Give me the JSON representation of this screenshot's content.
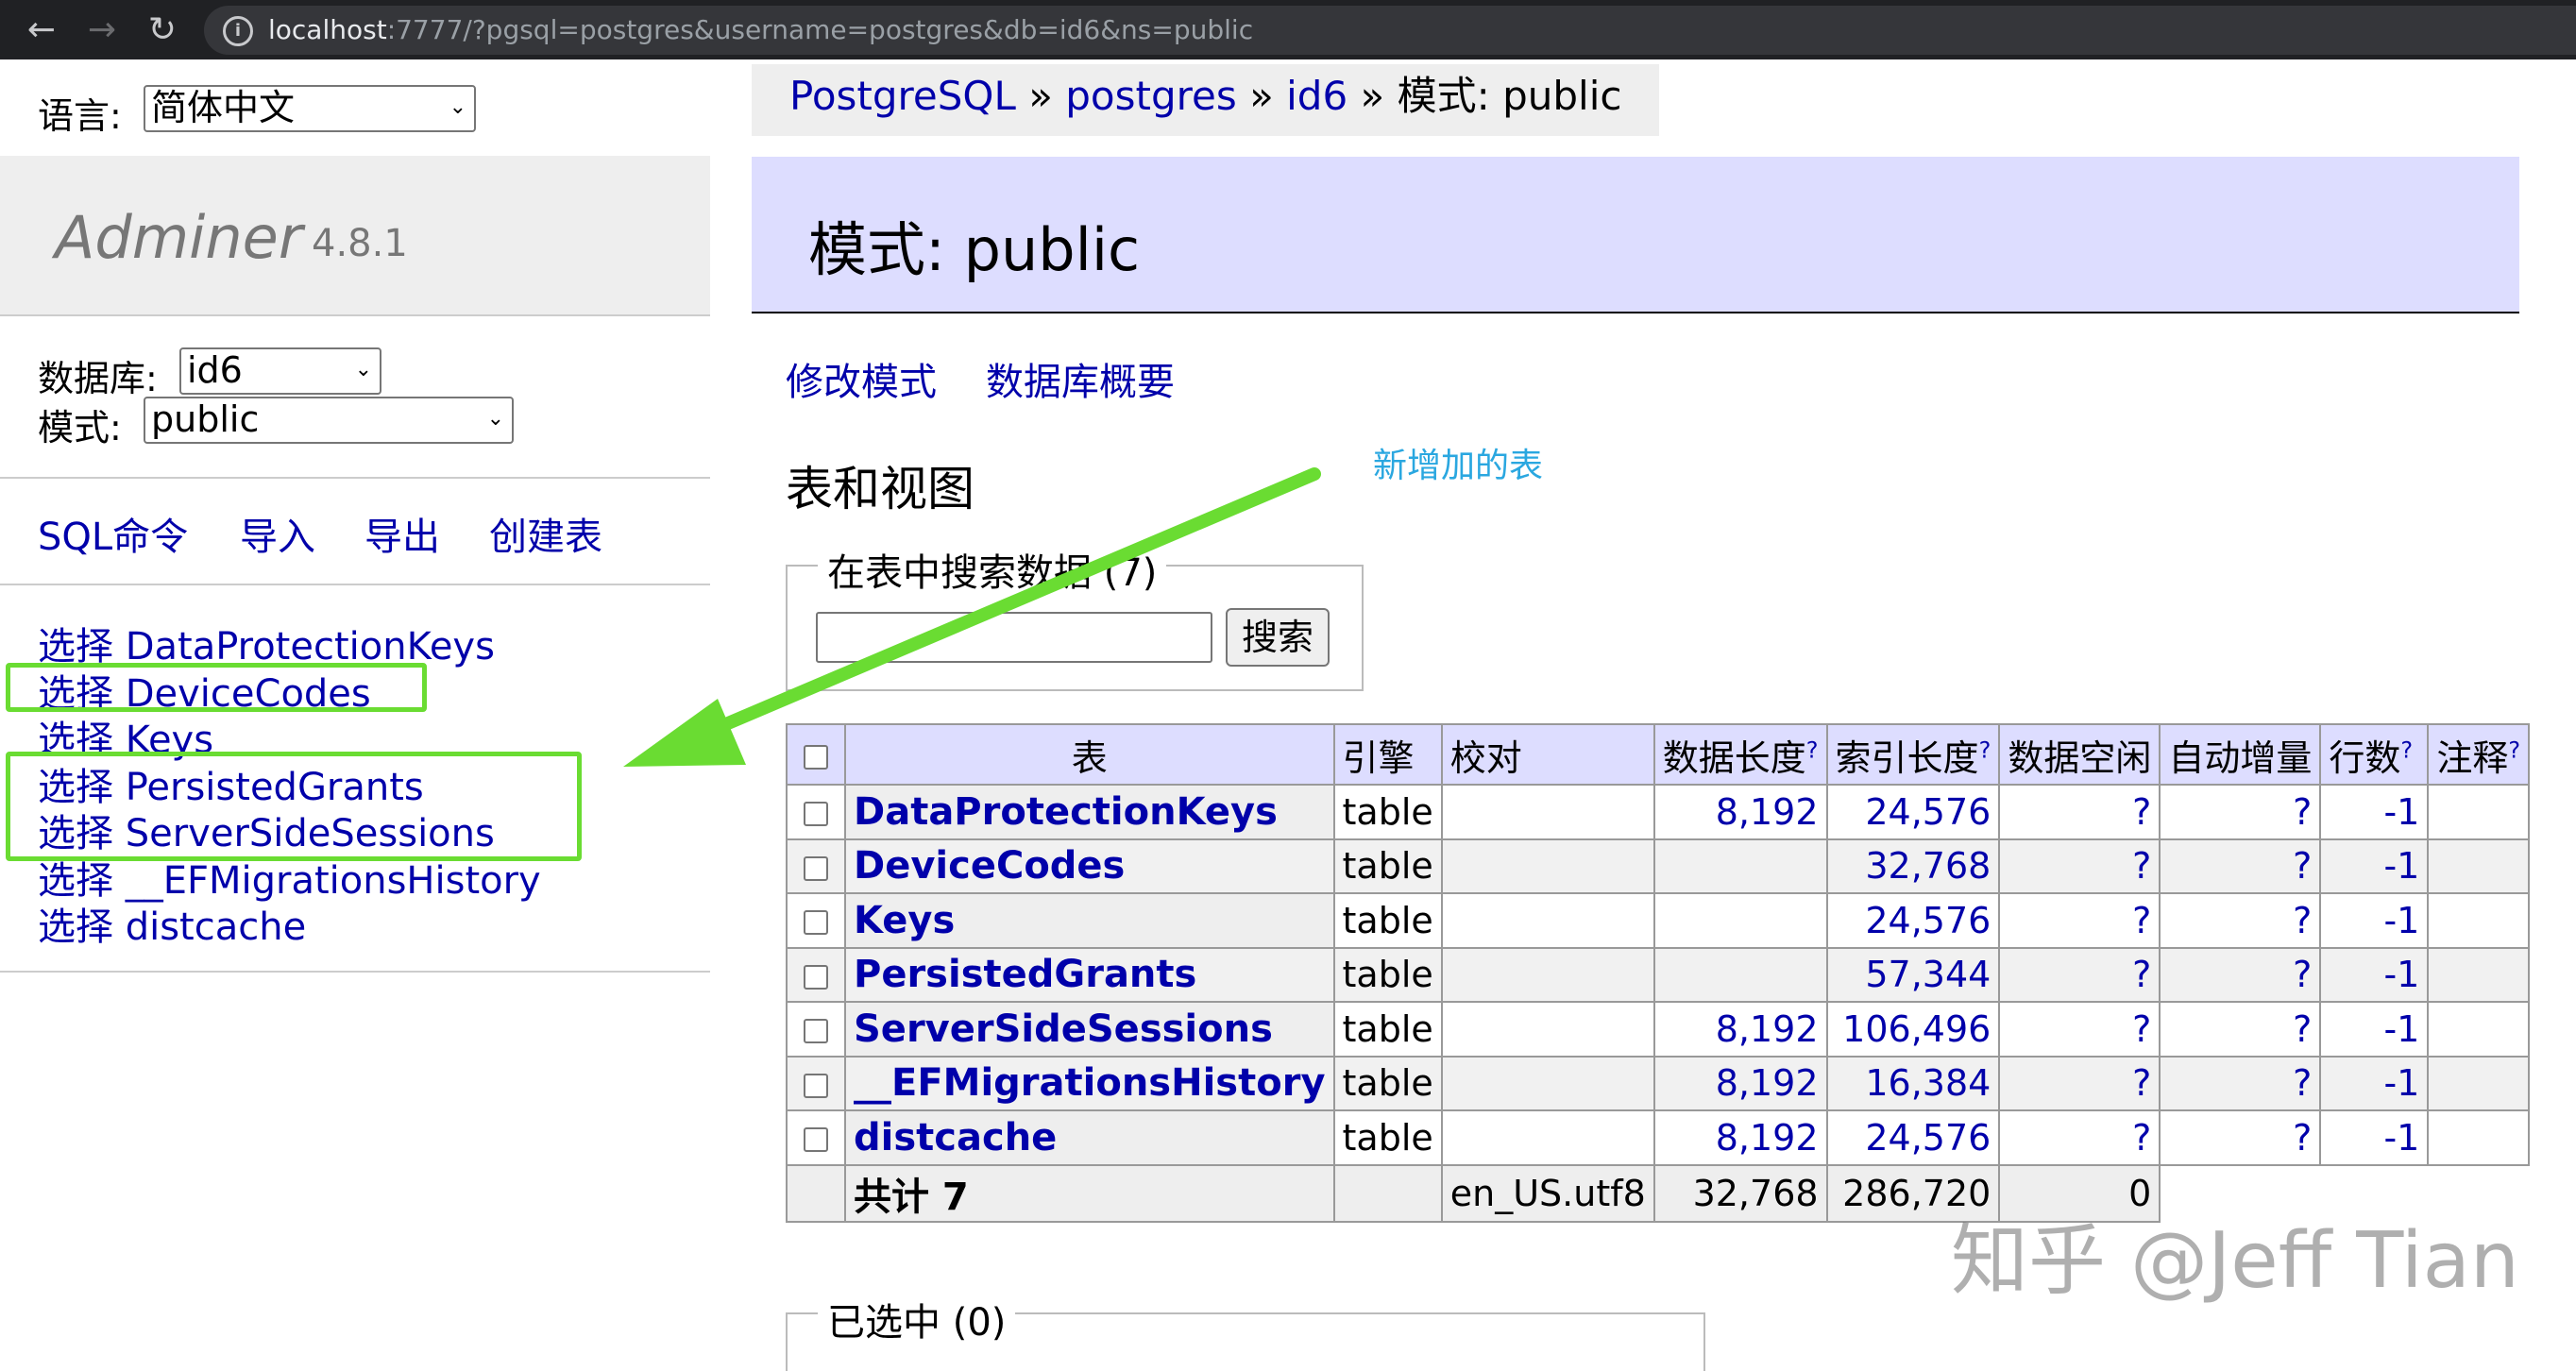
{
  "browser": {
    "url_host": "localhost",
    "url_rest": ":7777/?pgsql=postgres&username=postgres&db=id6&ns=public"
  },
  "sidebar": {
    "lang_label": "语言:",
    "lang_value": "简体中文",
    "brand_name": "Adminer",
    "brand_version": "4.8.1",
    "db_label": "数据库:",
    "db_value": "id6",
    "schema_label": "模式:",
    "schema_value": "public",
    "links": [
      "SQL命令",
      "导入",
      "导出",
      "创建表"
    ],
    "tables": [
      "选择 DataProtectionKeys",
      "选择 DeviceCodes",
      "选择 Keys",
      "选择 PersistedGrants",
      "选择 ServerSideSessions",
      "选择 __EFMigrationsHistory",
      "选择 distcache"
    ]
  },
  "breadcrumb": {
    "items": [
      "PostgreSQL",
      "postgres",
      "id6"
    ],
    "separator": "»",
    "current": "模式: public"
  },
  "page_title": "模式: public",
  "actions": [
    "修改模式",
    "数据库概要"
  ],
  "section_title": "表和视图",
  "annotation": "新增加的表",
  "search": {
    "legend": "在表中搜索数据 (7)",
    "button": "搜索",
    "value": ""
  },
  "table": {
    "headers": [
      "表",
      "引擎",
      "校对",
      "数据长度",
      "索引长度",
      "数据空闲",
      "自动增量",
      "行数",
      "注释"
    ],
    "help_mark": "?",
    "rows": [
      {
        "name": "DataProtectionKeys",
        "engine": "table",
        "collation": "",
        "data": "8,192",
        "index": "24,576",
        "free": "?",
        "auto": "?",
        "rows": "-1"
      },
      {
        "name": "DeviceCodes",
        "engine": "table",
        "collation": "",
        "data": "",
        "index": "32,768",
        "free": "?",
        "auto": "?",
        "rows": "-1"
      },
      {
        "name": "Keys",
        "engine": "table",
        "collation": "",
        "data": "",
        "index": "24,576",
        "free": "?",
        "auto": "?",
        "rows": "-1"
      },
      {
        "name": "PersistedGrants",
        "engine": "table",
        "collation": "",
        "data": "",
        "index": "57,344",
        "free": "?",
        "auto": "?",
        "rows": "-1"
      },
      {
        "name": "ServerSideSessions",
        "engine": "table",
        "collation": "",
        "data": "8,192",
        "index": "106,496",
        "free": "?",
        "auto": "?",
        "rows": "-1"
      },
      {
        "name": "__EFMigrationsHistory",
        "engine": "table",
        "collation": "",
        "data": "8,192",
        "index": "16,384",
        "free": "?",
        "auto": "?",
        "rows": "-1"
      },
      {
        "name": "distcache",
        "engine": "table",
        "collation": "",
        "data": "8,192",
        "index": "24,576",
        "free": "?",
        "auto": "?",
        "rows": "-1"
      }
    ],
    "total": {
      "label": "共计 7",
      "collation": "en_US.utf8",
      "data": "32,768",
      "index": "286,720",
      "free": "0"
    }
  },
  "selected_legend": "已选中 (0)",
  "watermark": "知乎 @Jeff Tian",
  "colors": {
    "link": "#0000aa",
    "highlight": "#6adc32",
    "annotation": "#2aa7e0",
    "header_bg": "#ddddff"
  }
}
